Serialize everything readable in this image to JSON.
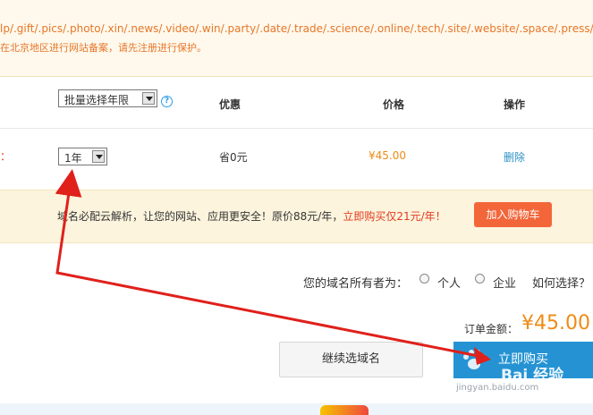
{
  "notice": {
    "line1": "lp/.gift/.pics/.photo/.xin/.news/.video/.win/.party/.date/.trade/.science/.online/.tech/.site/.website/.space/.press/.",
    "line2": "在北京地区进行网站备案，请先注册进行保护。"
  },
  "table": {
    "year_select": "批量选择年限",
    "help": "?",
    "col_discount": "优惠",
    "col_price": "价格",
    "col_action": "操作",
    "row": {
      "colon": "：",
      "year": "1年",
      "discount": "省0元",
      "price": "¥45.00",
      "delete": "删除"
    }
  },
  "promo": {
    "text_main": "域名必配云解析，让您的网站、应用更安全！原价88元/年，",
    "text_highlight": "立即购买仅21元/年！",
    "button": "加入购物车"
  },
  "owner": {
    "label": "您的域名所有者为：",
    "option_personal": "个人",
    "option_company": "企业",
    "help_link": "如何选择？"
  },
  "order": {
    "total_label": "订单金额：",
    "total_amount": "¥45.00",
    "continue_button": "继续选域名",
    "buy_button": "立即购买"
  },
  "watermark": {
    "brand": "Bai 经验",
    "url": "jingyan.baidu.com"
  },
  "colors": {
    "accent_orange": "#f08b16",
    "button_blue": "#2593d3",
    "arrow_red": "#e0201b"
  }
}
